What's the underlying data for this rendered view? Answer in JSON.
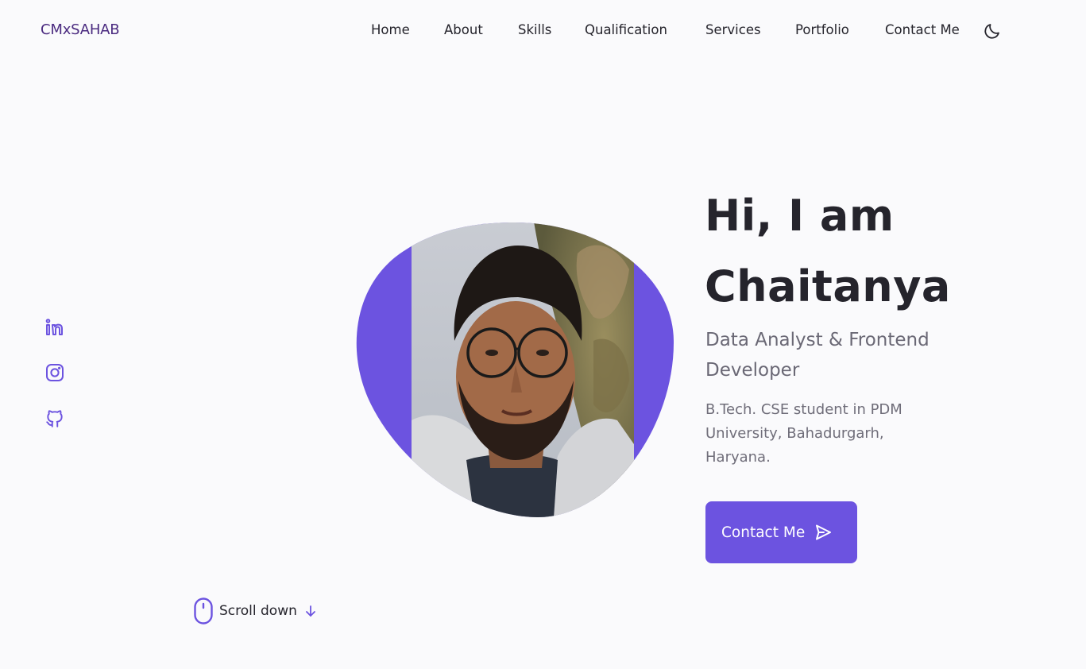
{
  "header": {
    "logo": "CMxSAHAB",
    "nav": [
      {
        "label": "Home"
      },
      {
        "label": "About"
      },
      {
        "label": "Skills"
      },
      {
        "label": "Qualification"
      },
      {
        "label": "Services"
      },
      {
        "label": "Portfolio"
      },
      {
        "label": "Contact Me"
      }
    ],
    "theme_toggle_icon": "moon-icon"
  },
  "social": [
    {
      "icon": "linkedin-icon"
    },
    {
      "icon": "instagram-icon"
    },
    {
      "icon": "github-icon"
    }
  ],
  "hero": {
    "title_line1": "Hi, I am",
    "title_line2": "Chaitanya",
    "subtitle": "Data Analyst & Frontend Developer",
    "description": "B.Tech. CSE student in PDM University, Bahadurgarh, Haryana.",
    "cta_label": "Contact Me",
    "cta_icon": "send-icon",
    "image": "profile-photo"
  },
  "scroll": {
    "label": "Scroll down",
    "mouse_icon": "mouse-icon",
    "arrow_icon": "arrow-down-icon"
  },
  "colors": {
    "accent": "#6c53e0",
    "logo": "#4b2b80",
    "text": "#25242c",
    "muted": "#6a6875",
    "background": "#fafafc"
  }
}
